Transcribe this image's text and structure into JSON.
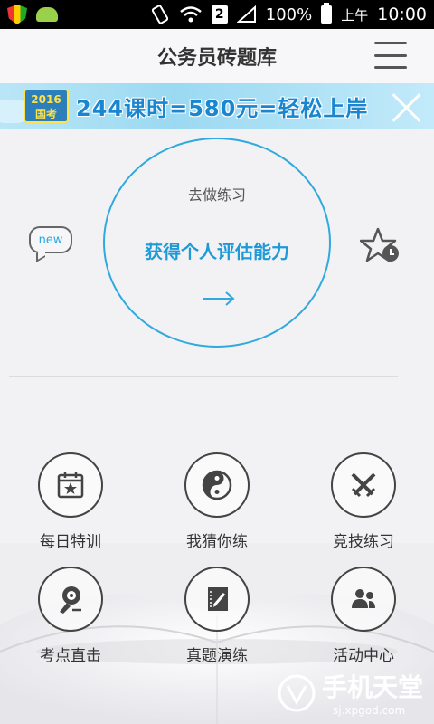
{
  "status_bar": {
    "battery": "100%",
    "am_pm": "上午",
    "time": "10:00",
    "sim_indicator": "2"
  },
  "header": {
    "title": "公务员砖题库",
    "menu_icon": "hamburger-menu-icon"
  },
  "banner": {
    "badge_year": "2016",
    "badge_text": "国考",
    "promo_text": "244课时=580元=轻松上岸",
    "close_icon": "close-icon"
  },
  "practice": {
    "subtitle": "去做练习",
    "headline": "获得个人评估能力",
    "new_badge": "new",
    "arrow_icon": "arrow-right-icon",
    "star_icon": "star-clock-icon"
  },
  "features": [
    {
      "label": "每日特训",
      "icon": "calendar-star-icon"
    },
    {
      "label": "我猜你练",
      "icon": "yin-yang-icon"
    },
    {
      "label": "竞技练习",
      "icon": "crossed-swords-icon"
    },
    {
      "label": "考点直击",
      "icon": "target-hand-icon"
    },
    {
      "label": "真题演练",
      "icon": "notebook-pen-icon"
    },
    {
      "label": "活动中心",
      "icon": "people-icon"
    }
  ],
  "watermark": {
    "title": "手机天堂",
    "url": "sj.xpgod.com"
  },
  "colors": {
    "accent": "#2fa9df",
    "banner_text": "#1a86d0"
  }
}
